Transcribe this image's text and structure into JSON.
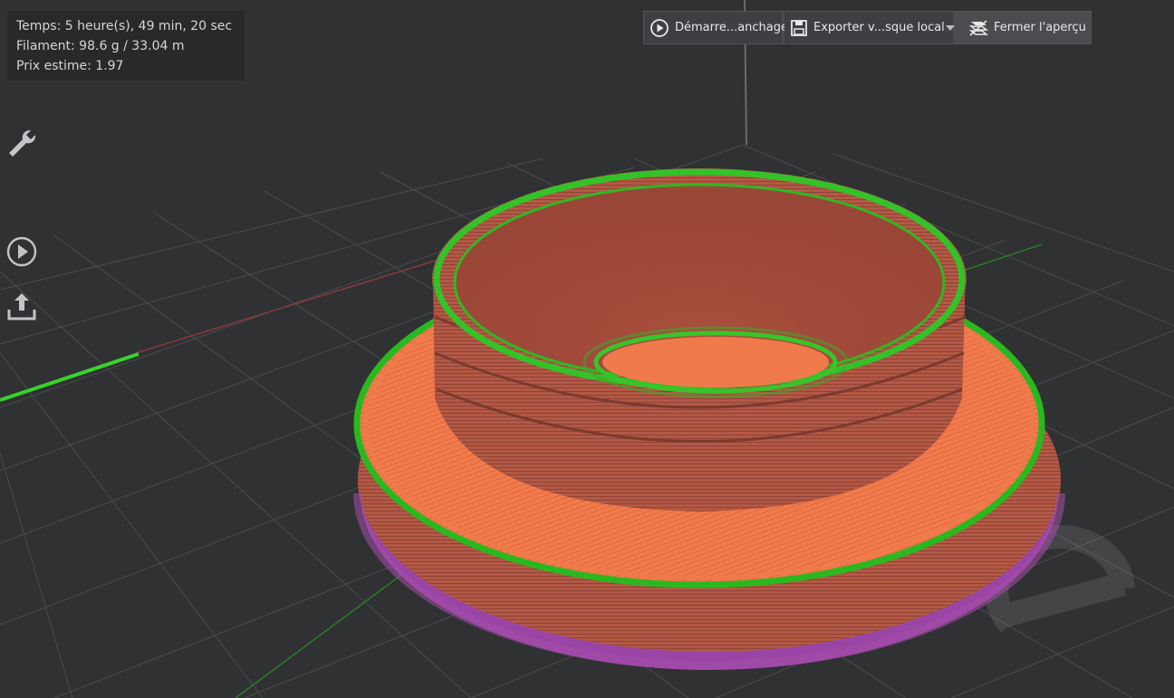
{
  "stats": {
    "time": "Temps: 5 heure(s), 49 min, 20 sec",
    "filament": "Filament: 98.6 g / 33.04 m",
    "price": "Prix estime: 1.97"
  },
  "toolbar": {
    "start_label": "Démarre...anchage",
    "export_label": "Exporter v...sque local",
    "close_label": "Fermer l'aperçu"
  },
  "sidebar": {
    "icons": [
      "wrench-icon",
      "play-circle-icon",
      "upload-icon"
    ]
  },
  "colors": {
    "background": "#2f3133",
    "model_wall": "#b55a47",
    "model_top": "#f0784a",
    "perimeter": "#35c22a",
    "support": "#9d45a8",
    "axis_x": "#b04040",
    "axis_y": "#2e8a2e"
  }
}
